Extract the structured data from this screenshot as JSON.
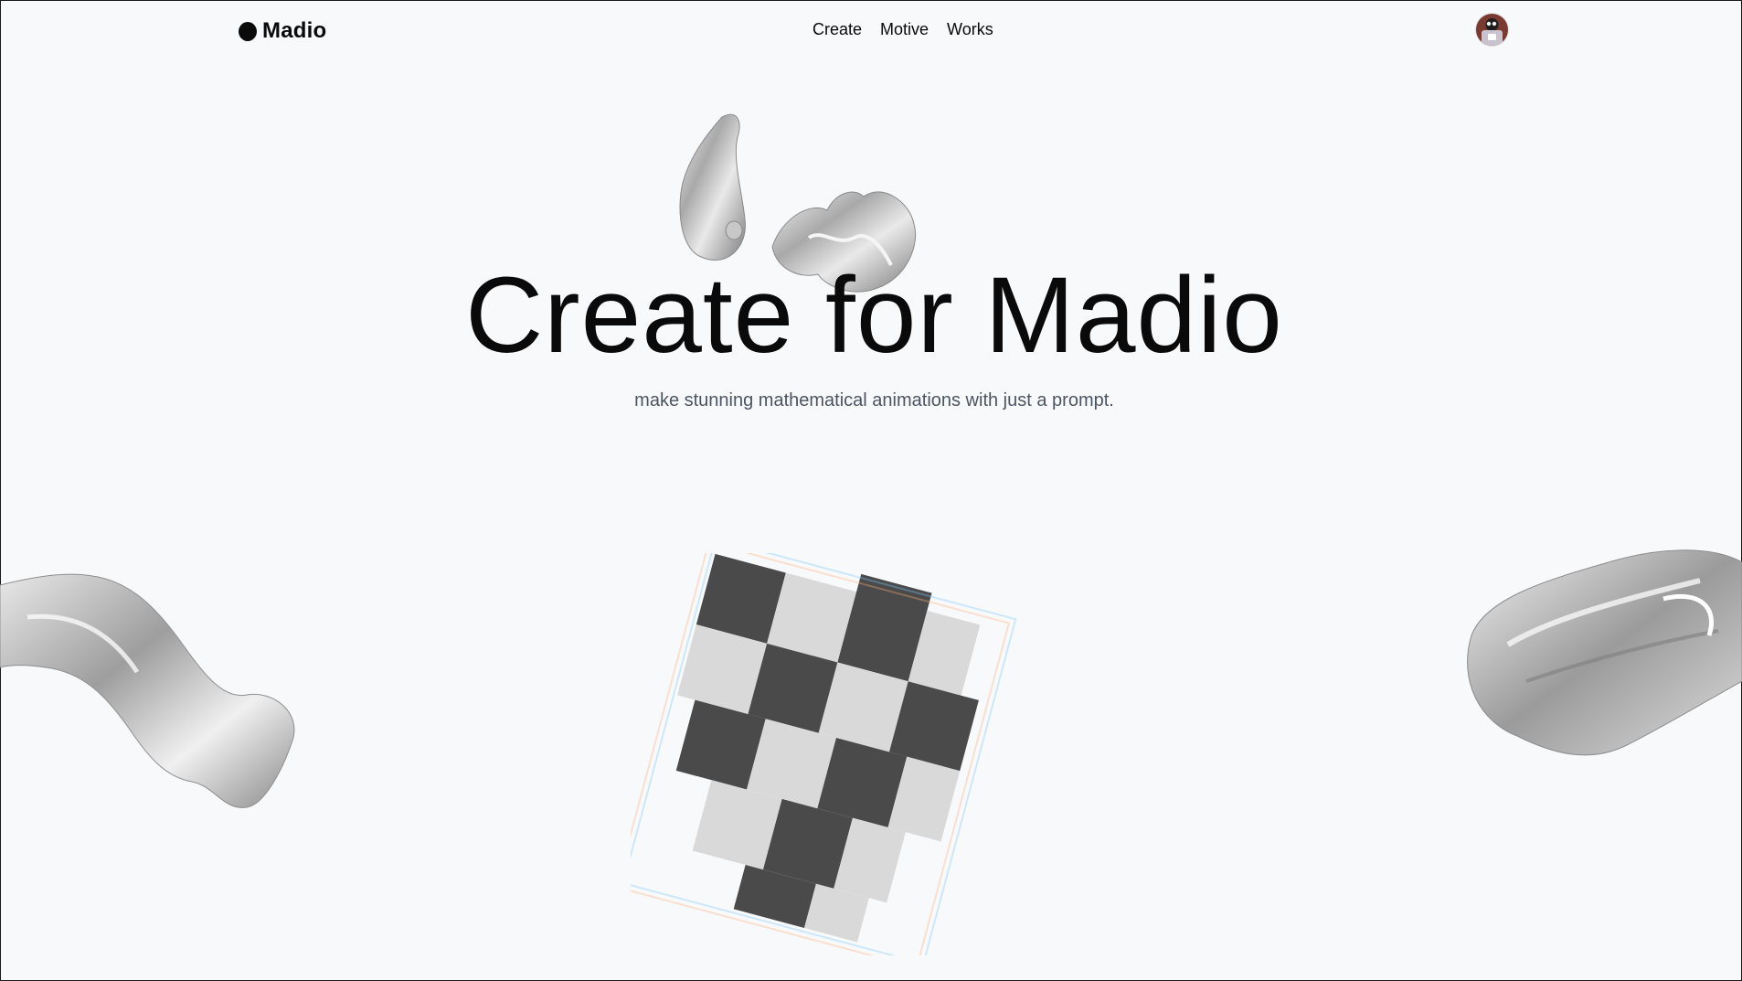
{
  "brand": {
    "name": "Madio"
  },
  "nav": {
    "items": [
      "Create",
      "Motive",
      "Works"
    ]
  },
  "hero": {
    "title": "Create for Madio",
    "subtitle": "make stunning mathematical animations with just a prompt."
  },
  "colors": {
    "background": "#f8f9fb",
    "text": "#0a0a0a",
    "subtitle": "#4b5563"
  },
  "icons": {
    "brand": "brand-dot-icon",
    "avatar": "user-avatar"
  }
}
